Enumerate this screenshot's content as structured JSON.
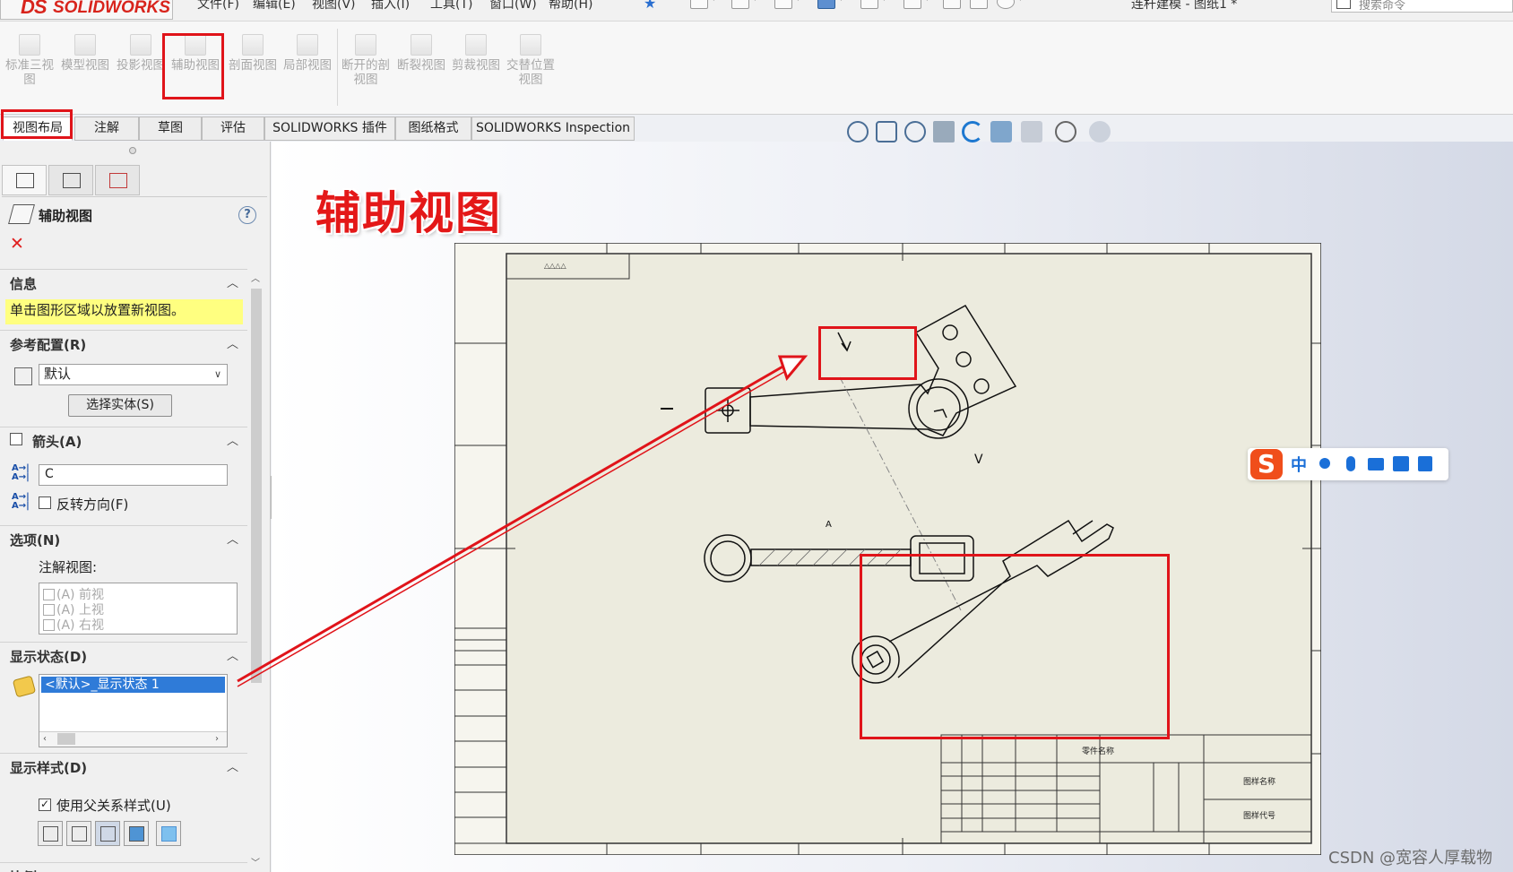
{
  "app": {
    "logo_mark": "DS",
    "logo_text": "SOLIDWORKS",
    "menus": [
      "文件(F)",
      "编辑(E)",
      "视图(V)",
      "插入(I)",
      "工具(T)",
      "窗口(W)",
      "帮助(H)"
    ],
    "window_title": "连杆建模 - 图纸1 *",
    "search_placeholder": "搜索命令"
  },
  "command_manager": {
    "buttons": [
      {
        "label": "标准三视图"
      },
      {
        "label": "模型视图"
      },
      {
        "label": "投影视图"
      },
      {
        "label": "辅助视图"
      },
      {
        "label": "剖面视图"
      },
      {
        "label": "局部视图"
      },
      {
        "label": "断开的剖视图"
      },
      {
        "label": "断裂视图"
      },
      {
        "label": "剪裁视图"
      },
      {
        "label": "交替位置视图"
      }
    ]
  },
  "tabs": [
    "视图布局",
    "注解",
    "草图",
    "评估",
    "SOLIDWORKS 插件",
    "图纸格式",
    "SOLIDWORKS Inspection"
  ],
  "property_manager": {
    "title": "辅助视图",
    "help": "?",
    "close": "✕",
    "info": {
      "header": "信息",
      "message": "单击图形区域以放置新视图。"
    },
    "reference_config": {
      "header": "参考配置(R)",
      "value": "默认",
      "select_button": "选择实体(S)"
    },
    "arrow": {
      "header": "箭头(A)",
      "label_value": "C",
      "reverse_label": "反转方向(F)"
    },
    "options": {
      "header": "选项(N)",
      "annotation_label": "注解视图:",
      "annotation_views": [
        "(A) 前视",
        "(A) 上视",
        "(A) 右视"
      ]
    },
    "display_state": {
      "header": "显示状态(D)",
      "selected": "<默认>_显示状态 1"
    },
    "display_style": {
      "header": "显示样式(D)",
      "use_parent_label": "使用父关系样式(U)"
    },
    "scale": {
      "header": "比例"
    }
  },
  "graphics": {
    "heading": "辅助视图",
    "title_block": {
      "sheet_name": "零件名称",
      "drawing_label": "图样名称",
      "drawing_number": "图样代号"
    }
  },
  "ime": {
    "logo": "S",
    "mode": "中"
  },
  "watermark": "CSDN @宽容人厚载物",
  "colors": {
    "highlight": "#e0141a",
    "accent": "#2f7bd8",
    "info_bg": "#ffff80"
  }
}
